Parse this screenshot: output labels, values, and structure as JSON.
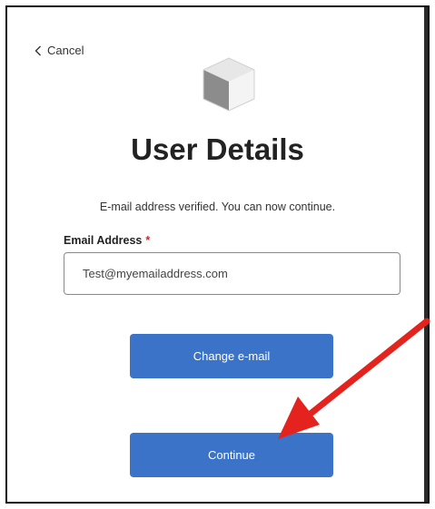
{
  "cancel": {
    "label": "Cancel",
    "icon": "chevron-left-icon"
  },
  "logo": {
    "icon": "cube-logo-icon"
  },
  "title": "User Details",
  "notice": "E-mail address verified. You can now continue.",
  "email": {
    "label": "Email Address",
    "required_mark": "*",
    "value": "Test@myemailaddress.com"
  },
  "buttons": {
    "change": "Change e-mail",
    "continue": "Continue"
  },
  "colors": {
    "primary": "#3a73c8",
    "required": "#c62828",
    "annotation_arrow": "#e5231e"
  }
}
